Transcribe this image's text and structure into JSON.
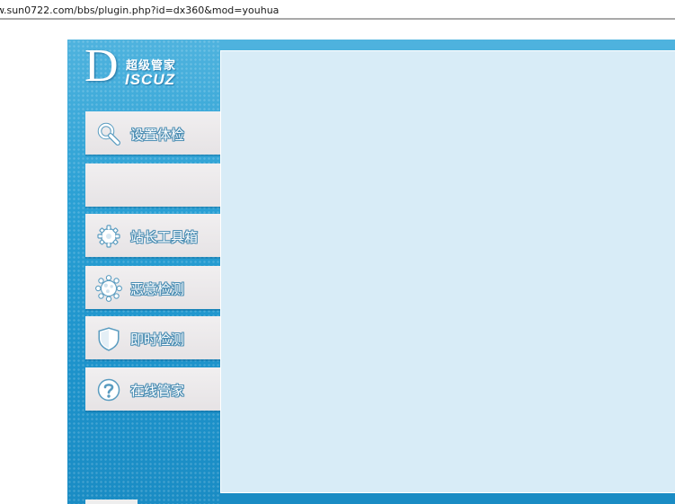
{
  "browser": {
    "address": "w.sun0722.com/bbs/plugin.php?id=dx360&mod=youhua"
  },
  "logo": {
    "letter": "D",
    "cn": "超级管家",
    "en": "ISCUZ"
  },
  "menu": [
    {
      "label": "设置体检",
      "icon": "search-icon"
    },
    {
      "label": "",
      "icon": ""
    },
    {
      "label": "站长工具箱",
      "icon": "gear-icon"
    },
    {
      "label": "恶意检测",
      "icon": "virus-icon"
    },
    {
      "label": "即时检测",
      "icon": "shield-icon"
    },
    {
      "label": "在线管家",
      "icon": "help-icon"
    }
  ],
  "colors": {
    "frame": "#1d93cb",
    "panel": "#d8ecf7",
    "menu_bg": "#e9e6e8",
    "icon": "#ffffff",
    "icon_outline": "#5a9cc0"
  }
}
